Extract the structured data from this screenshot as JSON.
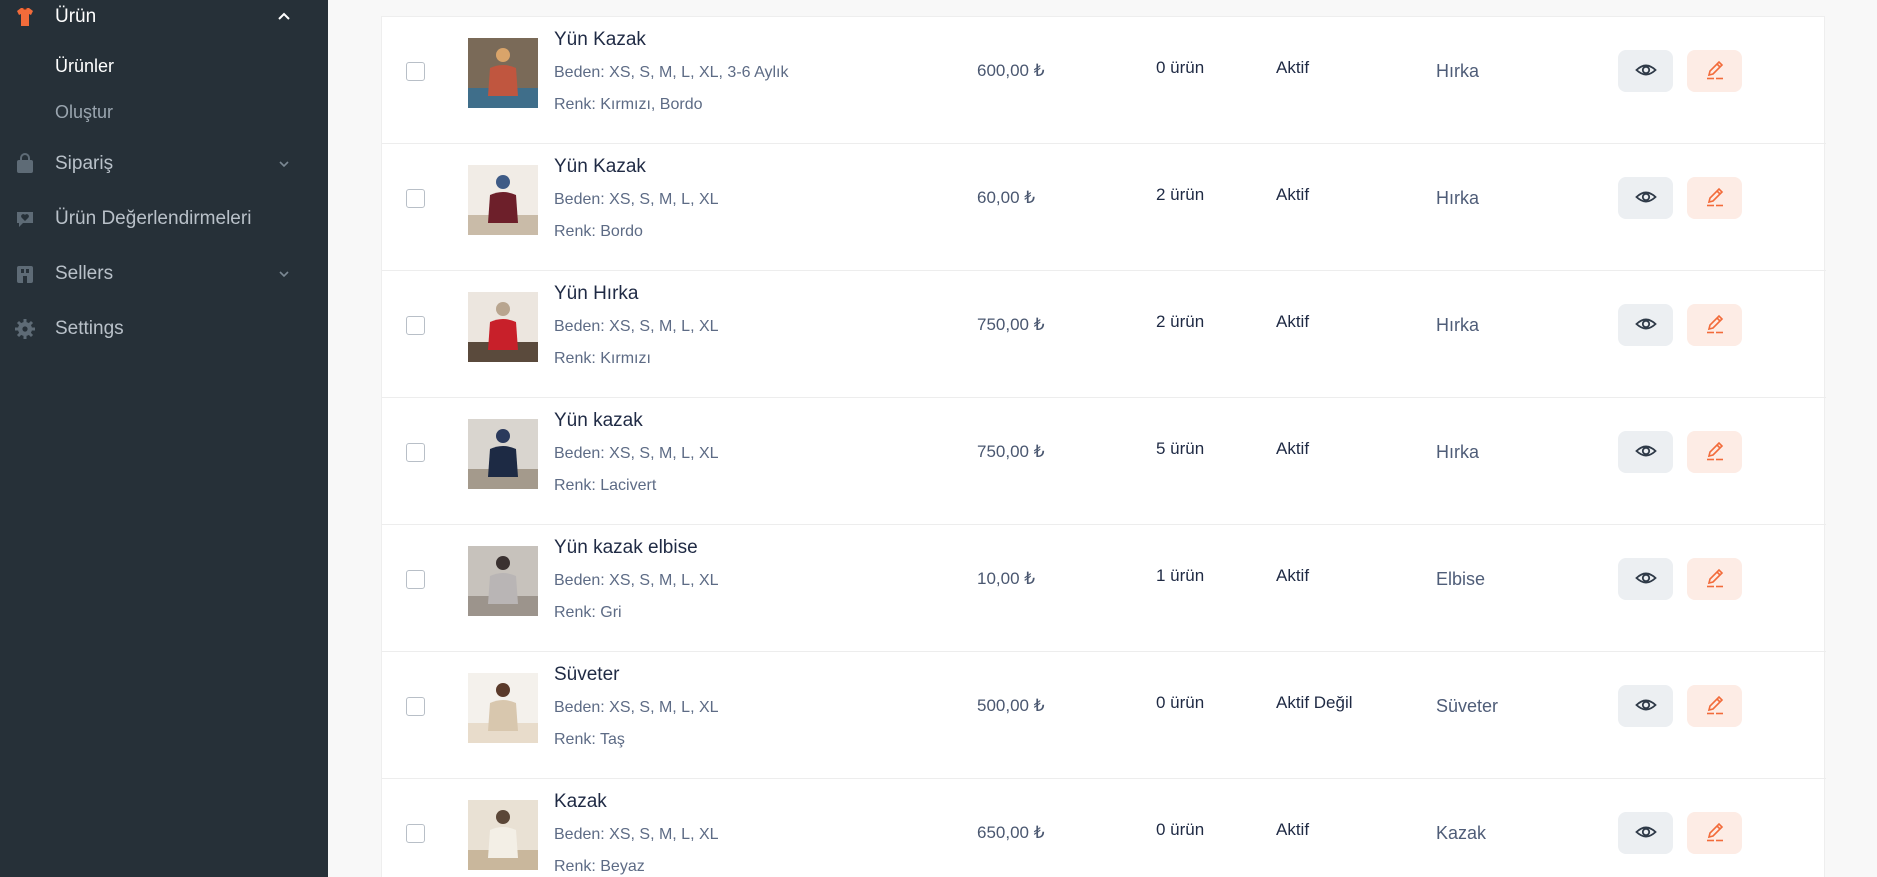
{
  "sidebar": {
    "sections": [
      {
        "label": "Ürün",
        "icon": "tshirt-icon",
        "expanded": true,
        "active": true,
        "children": [
          {
            "label": "Ürünler",
            "active": true
          },
          {
            "label": "Oluştur",
            "active": false
          }
        ]
      },
      {
        "label": "Sipariş",
        "icon": "shopping-bag-icon",
        "expanded": false
      },
      {
        "label": "Ürün Değerlendirmeleri",
        "icon": "heart-chat-icon"
      },
      {
        "label": "Sellers",
        "icon": "store-icon",
        "expanded": false
      },
      {
        "label": "Settings",
        "icon": "gear-icon"
      }
    ]
  },
  "products": [
    {
      "name": "Yün Kazak",
      "size": "Beden: XS, S, M, L, XL, 3-6 Aylık",
      "color": "Renk: Kırmızı, Bordo",
      "price": "600,00 ₺",
      "stock": "0 ürün",
      "status": "Aktif",
      "category": "Hırka",
      "image": "patchwork-cardigan-photo"
    },
    {
      "name": "Yün Kazak",
      "size": "Beden: XS, S, M, L, XL",
      "color": "Renk: Bordo",
      "price": "60,00 ₺",
      "stock": "2 ürün",
      "status": "Aktif",
      "category": "Hırka",
      "image": "bordo-sweater-photo"
    },
    {
      "name": "Yün Hırka",
      "size": "Beden: XS, S, M, L, XL",
      "color": "Renk: Kırmızı",
      "price": "750,00 ₺",
      "stock": "2 ürün",
      "status": "Aktif",
      "category": "Hırka",
      "image": "red-cardigan-photo"
    },
    {
      "name": "Yün kazak",
      "size": "Beden: XS, S, M, L, XL",
      "color": "Renk: Lacivert",
      "price": "750,00 ₺",
      "stock": "5 ürün",
      "status": "Aktif",
      "category": "Hırka",
      "image": "navy-sweater-photo"
    },
    {
      "name": "Yün kazak elbise",
      "size": "Beden: XS, S, M, L, XL",
      "color": "Renk: Gri",
      "price": "10,00 ₺",
      "stock": "1 ürün",
      "status": "Aktif",
      "category": "Elbise",
      "image": "grey-dress-photo"
    },
    {
      "name": "Süveter",
      "size": "Beden: XS, S, M, L, XL",
      "color": "Renk: Taş",
      "price": "500,00 ₺",
      "stock": "0 ürün",
      "status": "Aktif Değil",
      "category": "Süveter",
      "image": "stone-sweater-photo"
    },
    {
      "name": "Kazak",
      "size": "Beden: XS, S, M, L, XL",
      "color": "Renk: Beyaz",
      "price": "650,00 ₺",
      "stock": "0 ürün",
      "status": "Aktif",
      "category": "Kazak",
      "image": "white-sweater-photo"
    }
  ],
  "actions": {
    "view_icon": "eye-icon",
    "edit_icon": "pencil-icon"
  },
  "colors": {
    "sidebar_bg": "#263038",
    "accent": "#f26b3a",
    "view_btn_bg": "#eceff2",
    "edit_btn_bg": "#fdece5"
  }
}
